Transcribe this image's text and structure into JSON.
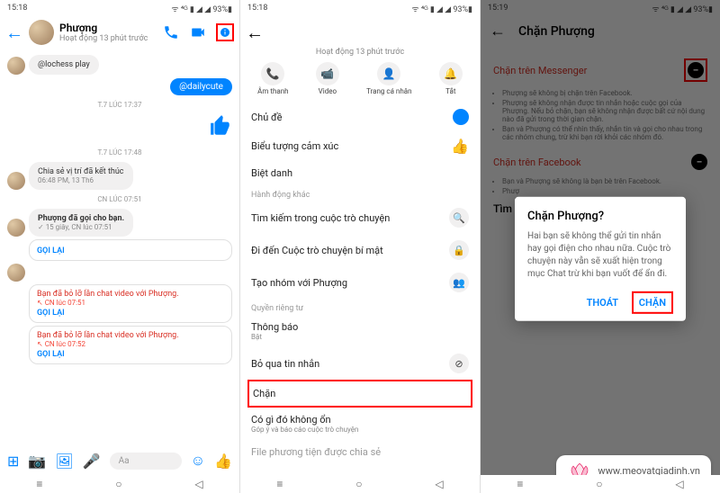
{
  "status": {
    "time1": "15:18",
    "time2": "15:18",
    "time3": "15:19",
    "icons": "⌂ ⊕",
    "signal": "ᯤ ⁴ᴳ ▮ ◢ ◢ 93%▮"
  },
  "p1": {
    "name": "Phượng",
    "activity": "Hoạt động 13 phút trước",
    "handle_msg": "@lochess play",
    "pill": "@dailycute",
    "ts1": "T.7 LÚC 17:37",
    "ts2": "T.7 LÚC 17:48",
    "share": "Chia sẻ vị trí đã kết thúc",
    "share_time": "06:48 PM, 13 Th6",
    "ts3": "CN LÚC 07:51",
    "call_in": "Phượng đã gọi cho bạn.",
    "call_in_time": "✓ 15 giây, CN lúc 07:51",
    "goi_lai": "GỌI LẠI",
    "missed": "Bạn đã bỏ lỡ lần chat video với Phượng.",
    "missed_time1": "↖ CN lúc 07:51",
    "missed_time2": "↖ CN lúc 07:52",
    "placeholder": "Aa"
  },
  "p2": {
    "activity": "Hoạt động 13 phút trước",
    "quick": {
      "audio": "Âm thanh",
      "video": "Video",
      "profile": "Trang cá nhân",
      "off": "Tắt"
    },
    "theme": "Chủ đề",
    "emoji": "Biểu tượng cảm xúc",
    "nickname": "Biệt danh",
    "sec_actions": "Hành động khác",
    "search": "Tìm kiếm trong cuộc trò chuyện",
    "secret": "Đi đến Cuộc trò chuyện bí mật",
    "group": "Tạo nhóm với Phượng",
    "sec_privacy": "Quyền riêng tư",
    "notif": "Thông báo",
    "notif_sub": "Bật",
    "ignore": "Bỏ qua tin nhắn",
    "block": "Chặn",
    "wrong": "Có gì đó không ổn",
    "wrong_sub": "Góp ý và báo cáo cuộc trò chuyện",
    "files": "File phương tiện được chia sẻ"
  },
  "p3": {
    "title": "Chặn Phượng",
    "row1": "Chặn trên Messenger",
    "b1": "Phượng sẽ không bị chặn trên Facebook.",
    "b2": "Phượng sẽ không nhận được tin nhắn hoặc cuộc gọi của Phượng. Nếu bỏ chặn, bạn sẽ không nhận được bất cứ nội dung nào đã gửi trong thời gian chặn.",
    "b3": "Bạn và Phượng có thể nhìn thấy, nhắn tin và gọi cho nhau trong các nhóm chung, trừ khi bạn rời khỏi các nhóm đó.",
    "row2": "Chặn trên Facebook",
    "b4": "Bạn và Phượng sẽ không là bạn bè trên Facebook.",
    "b5": "Phượ",
    "timh": "Tìm h",
    "dialog_title": "Chặn Phượng?",
    "dialog_body": "Hai bạn sẽ không thể gửi tin nhắn hay gọi điện cho nhau nữa. Cuộc trò chuyện này vẫn sẽ xuất hiện trong mục Chat trừ khi bạn vuốt để ẩn đi.",
    "thoat": "THOÁT",
    "chan": "CHẶN"
  },
  "watermark": "www.meovatgiadinh.vn"
}
